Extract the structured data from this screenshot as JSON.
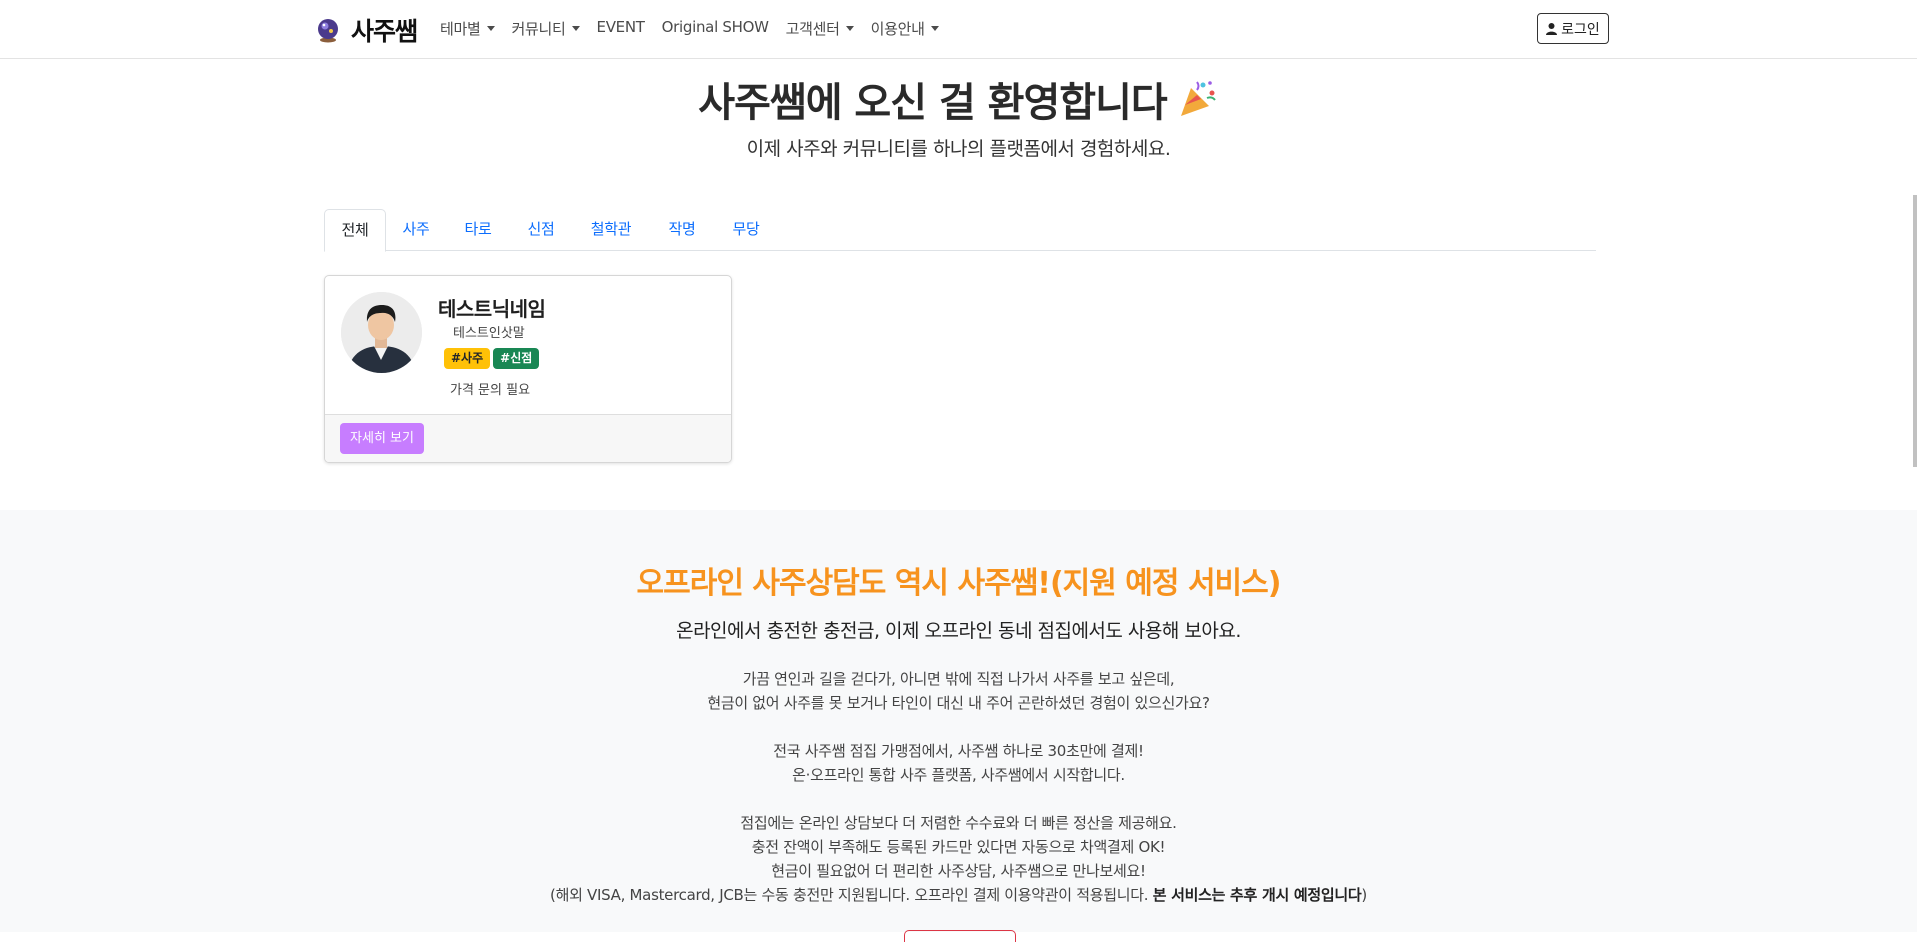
{
  "brand": {
    "name": "사주쌤",
    "logo_icon": "crystal-ball-icon"
  },
  "nav": {
    "items": [
      {
        "label": "테마별",
        "dropdown": true
      },
      {
        "label": "커뮤니티",
        "dropdown": true
      },
      {
        "label": "EVENT",
        "dropdown": false
      },
      {
        "label": "Original SHOW",
        "dropdown": false
      },
      {
        "label": "고객센터",
        "dropdown": true
      },
      {
        "label": "이용안내",
        "dropdown": true
      }
    ],
    "login_label": "로그인"
  },
  "hero": {
    "title": "사주쌤에 오신 걸 환영합니다",
    "title_icon": "party-popper-icon",
    "subtitle": "이제 사주와 커뮤니티를 하나의 플랫폼에서 경험하세요."
  },
  "tabs": {
    "items": [
      {
        "label": "전체",
        "active": true
      },
      {
        "label": "사주",
        "active": false
      },
      {
        "label": "타로",
        "active": false
      },
      {
        "label": "신점",
        "active": false
      },
      {
        "label": "철학관",
        "active": false
      },
      {
        "label": "작명",
        "active": false
      },
      {
        "label": "무당",
        "active": false
      }
    ]
  },
  "card": {
    "name": "테스트닉네임",
    "intro": "테스트인삿말",
    "tags": [
      "#사주",
      "#신점"
    ],
    "price": "가격 문의 필요",
    "detail_label": "자세히 보기"
  },
  "offline": {
    "title": "오프라인 사주상담도 역시 사주쌤!(지원 예정 서비스)",
    "subtitle": "온라인에서 충전한 충전금, 이제 오프라인 동네 점집에서도 사용해 보아요.",
    "para1": [
      "가끔 연인과 길을 걷다가, 아니면 밖에 직접 나가서 사주를 보고 싶은데,",
      "현금이 없어 사주를 못 보거나 타인이 대신 내 주어 곤란하셨던 경험이 있으신가요?"
    ],
    "para2": [
      "전국 사주쌤 점집 가맹점에서, 사주쌤 하나로 30초만에 결제!",
      "온·오프라인 통합 사주 플랫폼, 사주쌤에서 시작합니다."
    ],
    "para3": [
      "점집에는 온라인 상담보다 더 저렴한 수수료와 더 빠른 정산을 제공해요.",
      "충전 잔액이 부족해도 등록된 카드만 있다면 자동으로 차액결제 OK!",
      "현금이 필요없어 더 편리한 사주상담, 사주쌤으로 만나보세요!"
    ],
    "note_prefix": "(해외 VISA, Mastercard, JCB는 수동 충전만 지원됩니다. 오프라인 결제 이용약관이 적용됩니다. ",
    "note_bold": "본 서비스는 추후 개시 예정입니다",
    "note_suffix": ")"
  },
  "colors": {
    "accent_orange": "#f7931e",
    "link_blue": "#0d6efd",
    "button_purple": "#c77dff",
    "badge_yellow": "#ffc107",
    "badge_green": "#198754"
  }
}
